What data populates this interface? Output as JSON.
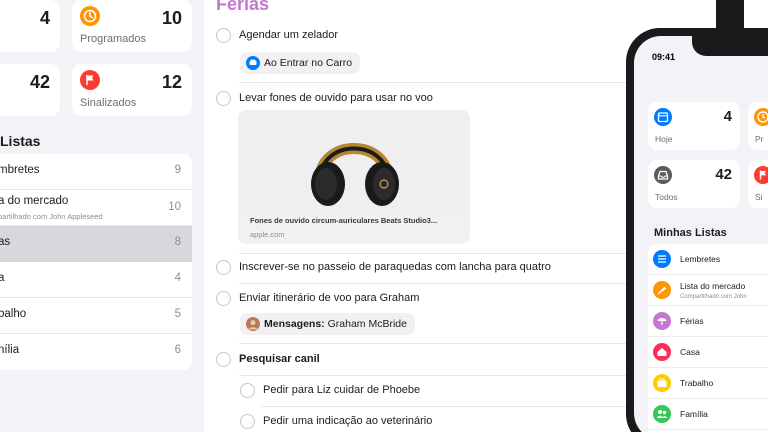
{
  "colors": {
    "list_title": "#c477d1",
    "scheduled": "#ff9500",
    "flagged": "#ff3b30",
    "today": "#007aff",
    "all": "#5b5b60"
  },
  "sidebar": {
    "cards": [
      {
        "label": "",
        "count": "4",
        "icon": "today-icon"
      },
      {
        "label": "Programados",
        "count": "10",
        "icon": "clock-icon"
      },
      {
        "label": "",
        "count": "42",
        "icon": "tray-icon"
      },
      {
        "label": "Sinalizados",
        "count": "12",
        "icon": "flag-icon"
      }
    ],
    "lists_heading": "Listas",
    "lists": [
      {
        "name": "mbretes",
        "count": "9"
      },
      {
        "name": "a do mercado",
        "count": "10",
        "sub": "partilhado com John Appleseed"
      },
      {
        "name": "as",
        "count": "8",
        "selected": true
      },
      {
        "name": "a",
        "count": "4"
      },
      {
        "name": "balho",
        "count": "5"
      },
      {
        "name": "nília",
        "count": "6"
      }
    ]
  },
  "main": {
    "title": "Férias",
    "reminders": [
      {
        "text": "Agendar um zelador",
        "chip": "Ao Entrar no Carro"
      },
      {
        "text": "Levar fones de ouvido para usar no voo"
      },
      {
        "text": "Inscrever-se no passeio de paraquedas com lancha para quatro"
      },
      {
        "text": "Enviar itinerário de voo para Graham",
        "chip_label": "Mensagens:",
        "chip_value": "Graham McBride"
      },
      {
        "text": "Pesquisar canil"
      },
      {
        "text": "Pedir para Liz cuidar de Phoebe"
      },
      {
        "text": "Pedir uma indicação ao veterinário"
      }
    ],
    "link_card": {
      "title": "Fones de ouvido circum-auriculares Beats Studio3...",
      "domain": "apple.com"
    }
  },
  "phone": {
    "time": "09:41",
    "cards": [
      {
        "label": "Hoje",
        "count": "4",
        "icon": "calendar-icon"
      },
      {
        "label": "Pr",
        "count": "",
        "icon": "clock-icon"
      },
      {
        "label": "Todos",
        "count": "42",
        "icon": "tray-icon"
      },
      {
        "label": "Si",
        "count": "",
        "icon": "flag-icon"
      }
    ],
    "lists_heading": "Minhas Listas",
    "lists": [
      {
        "name": "Lembretes",
        "icon": "list-icon",
        "color": "#007aff"
      },
      {
        "name": "Lista do mercado",
        "sub": "Compartilhado com John",
        "icon": "carrot-icon",
        "color": "#ff9500"
      },
      {
        "name": "Férias",
        "icon": "umbrella-icon",
        "color": "#c477d1"
      },
      {
        "name": "Casa",
        "icon": "house-icon",
        "color": "#ff2d55"
      },
      {
        "name": "Trabalho",
        "icon": "briefcase-icon",
        "color": "#ffcc00"
      },
      {
        "name": "Família",
        "icon": "people-icon",
        "color": "#34c759"
      }
    ]
  }
}
